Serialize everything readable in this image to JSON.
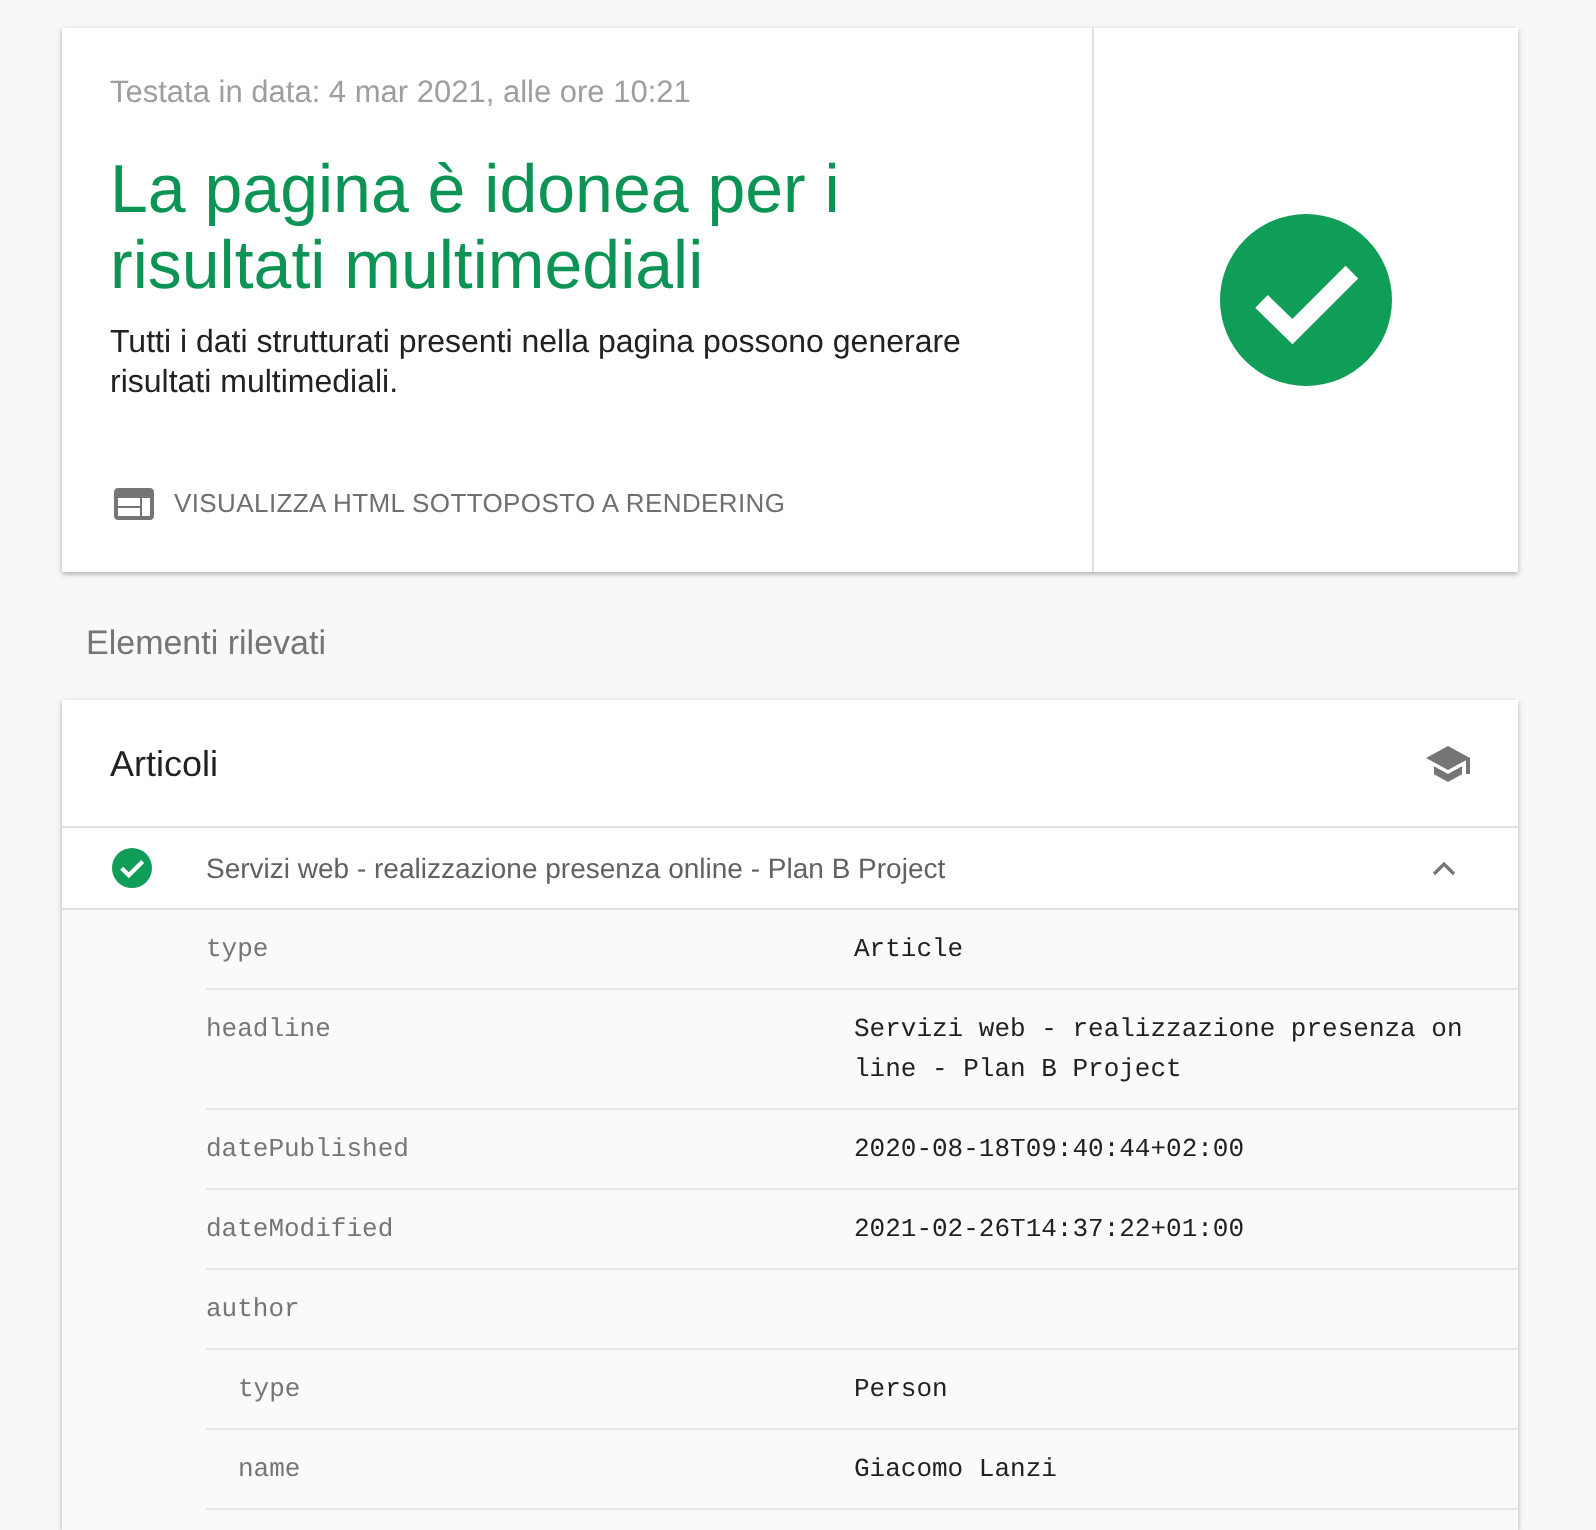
{
  "test_result": {
    "tested_at": "Testata in data: 4 mar 2021, alle ore 10:21",
    "headline": "La pagina è idonea per i risultati multimediali",
    "description": "Tutti i dati strutturati presenti nella pagina possono generare risultati multimediali.",
    "valid": true,
    "action": "VISUALIZZA HTML SOTTOPOSTO A RENDERING"
  },
  "detected_items": {
    "heading": "Elementi rilevati",
    "groups": [
      {
        "title": "Articoli",
        "items": [
          {
            "title": "Servizi web - realizzazione presenza online - Plan B Project",
            "valid": true,
            "expanded": true,
            "properties": [
              {
                "key": "type",
                "value": "Article"
              },
              {
                "key": "headline",
                "value": "Servizi web - realizzazione presenza online - Plan B Project"
              },
              {
                "key": "datePublished",
                "value": "2020-08-18T09:40:44+02:00"
              },
              {
                "key": "dateModified",
                "value": "2021-02-26T14:37:22+01:00"
              },
              {
                "key": "author",
                "children": [
                  {
                    "key": "type",
                    "value": "Person"
                  },
                  {
                    "key": "name",
                    "value": "Giacomo Lanzi"
                  }
                ]
              }
            ]
          }
        ]
      }
    ]
  }
}
